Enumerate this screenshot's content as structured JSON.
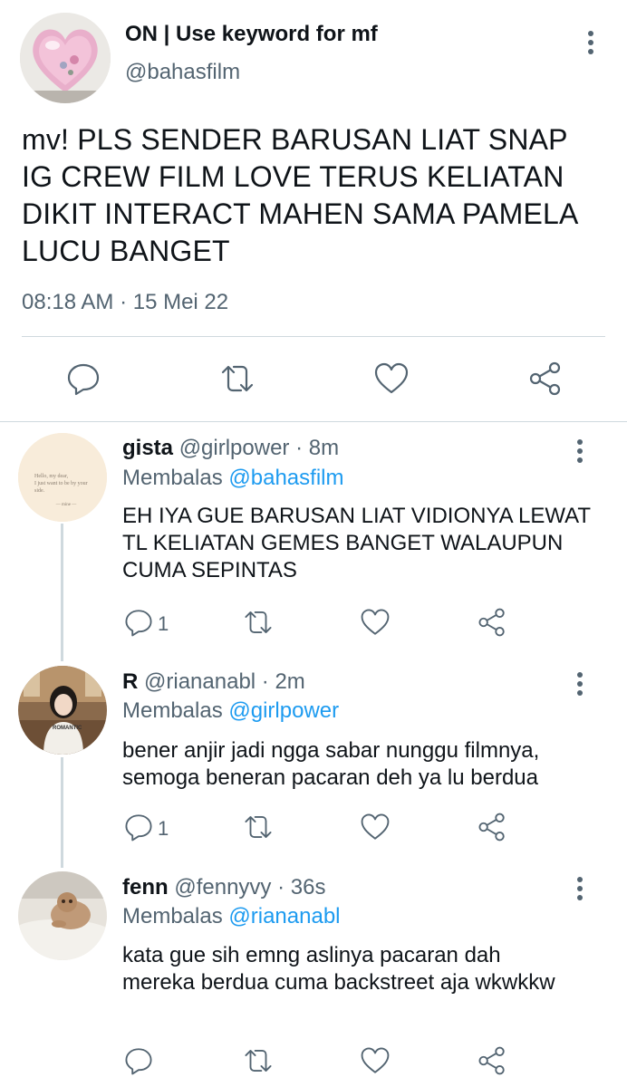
{
  "main_tweet": {
    "display_name": "ON | Use keyword for mf",
    "handle": "@bahasfilm",
    "text": "mv! PLS SENDER BARUSAN LIAT SNAP IG CREW FILM LOVE TERUS KELIATAN DIKIT INTERACT MAHEN SAMA PAMELA LUCU BANGET",
    "timestamp": "08:18 AM · 15 Mei 22",
    "avatar_icon": "pink-heart-avatar",
    "actions": [
      "reply-icon",
      "retweet-icon",
      "like-icon",
      "share-icon"
    ]
  },
  "replies": [
    {
      "display_name": "gista",
      "handle": "@girlpower",
      "time": "· 8m",
      "replying_prefix": "Membalas",
      "replying_to": "@bahasfilm",
      "text": "EH IYA GUE BARUSAN LIAT VIDIONYA LEWAT TL KELIATAN GEMES BANGET WALAUPUN CUMA SEPINTAS",
      "reply_count": "1",
      "avatar_text_1": "Hello, my dear,",
      "avatar_text_2": "I just want to be by your side.",
      "avatar_text_3": "— mine —"
    },
    {
      "display_name": "R",
      "handle": "@riananabl",
      "time": "· 2m",
      "replying_prefix": "Membalas",
      "replying_to": "@girlpower",
      "text": "bener anjir jadi ngga sabar nunggu filmnya, semoga beneran pacaran deh ya lu berdua",
      "reply_count": "1",
      "avatar_shirt_text": "ROMANTIC"
    },
    {
      "display_name": "fenn",
      "handle": "@fennyvy",
      "time": "· 36s",
      "replying_prefix": "Membalas",
      "replying_to": "@riananabl",
      "text": "kata gue sih emng aslinya pacaran dah mereka berdua cuma backstreet aja wkwkkw",
      "reply_count": ""
    }
  ]
}
